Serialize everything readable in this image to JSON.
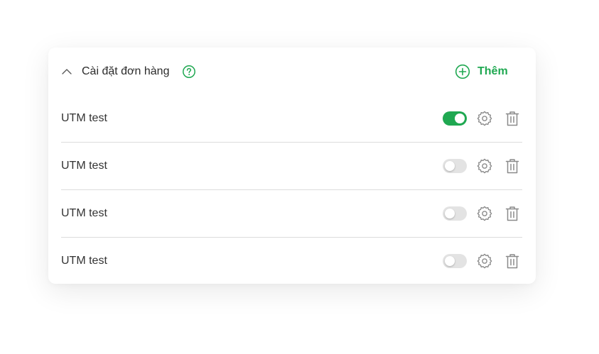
{
  "section": {
    "title": "Cài đặt đơn hàng",
    "add_label": "Thêm"
  },
  "colors": {
    "accent": "#1fa851",
    "toggle_off": "#e3e3e3",
    "icon": "#8a8a8a"
  },
  "rows": [
    {
      "label": "UTM test",
      "enabled": true
    },
    {
      "label": "UTM test",
      "enabled": false
    },
    {
      "label": "UTM test",
      "enabled": false
    },
    {
      "label": "UTM test",
      "enabled": false
    }
  ]
}
